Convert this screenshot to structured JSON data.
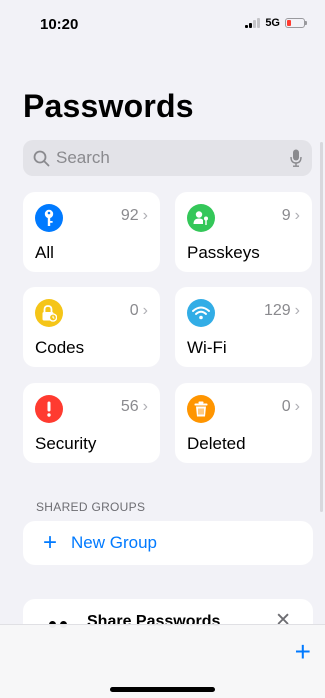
{
  "status_bar": {
    "time": "10:20",
    "network": "5G"
  },
  "title": "Passwords",
  "search": {
    "placeholder": "Search"
  },
  "categories": [
    {
      "label": "All",
      "count": "92",
      "icon": "key-icon",
      "color": "#007aff"
    },
    {
      "label": "Passkeys",
      "count": "9",
      "icon": "person-key-icon",
      "color": "#34c759"
    },
    {
      "label": "Codes",
      "count": "0",
      "icon": "lock-clock-icon",
      "color": "#f5c518"
    },
    {
      "label": "Wi-Fi",
      "count": "129",
      "icon": "wifi-icon",
      "color": "#32ade6"
    },
    {
      "label": "Security",
      "count": "56",
      "icon": "exclamation-icon",
      "color": "#ff3b30"
    },
    {
      "label": "Deleted",
      "count": "0",
      "icon": "trash-icon",
      "color": "#ff9500"
    }
  ],
  "shared_groups": {
    "header": "SHARED GROUPS",
    "new_group_label": "New Group"
  },
  "share_card": {
    "title": "Share Passwords"
  },
  "colors": {
    "accent": "#007aff",
    "background": "#f2f2f7"
  }
}
